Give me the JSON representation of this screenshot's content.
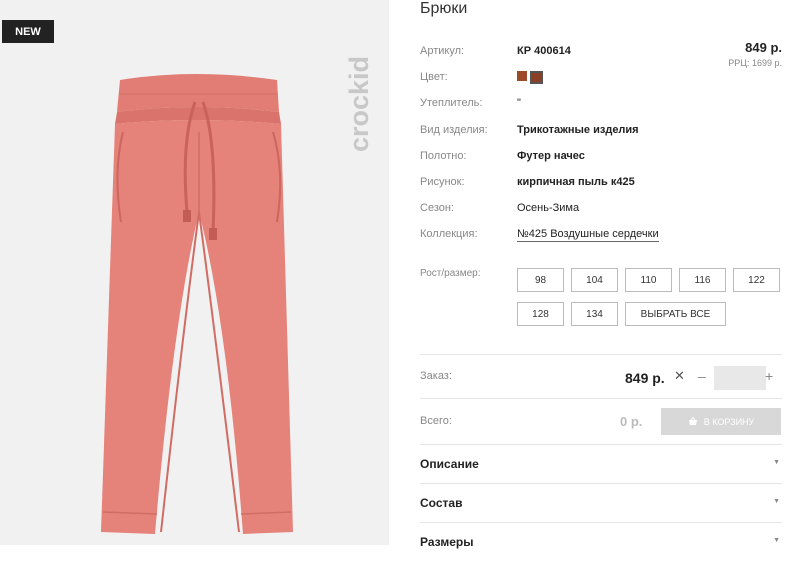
{
  "badge": "NEW",
  "brand": "crockid",
  "product": {
    "title": "Брюки",
    "price": "849 р.",
    "rrp": "РРЦ: 1699 р."
  },
  "attributes": [
    {
      "label": "Артикул:",
      "value": "КР 400614",
      "bold": true
    },
    {
      "label": "Цвет:",
      "value": ""
    },
    {
      "label": "Утеплитель:",
      "value": "\""
    },
    {
      "label": "Вид изделия:",
      "value": "Трикотажные изделия",
      "bold": true
    },
    {
      "label": "Полотно:",
      "value": "Футер начес",
      "bold": true
    },
    {
      "label": "Рисунок:",
      "value": "кирпичная пыль к425",
      "bold": true
    },
    {
      "label": "Сезон:",
      "value": "Осень-Зима"
    },
    {
      "label": "Коллекция:",
      "value": "№425 Воздушные сердечки",
      "link": true
    }
  ],
  "colors": {
    "swatch": "#9b4a2a",
    "cart_button": "#d8d8d8",
    "image_bg": "#f1f1f1"
  },
  "sizes": {
    "label": "Рост/размер:",
    "options": [
      "98",
      "104",
      "110",
      "116",
      "122",
      "128",
      "134"
    ],
    "select_all": "ВЫБРАТЬ ВСЕ"
  },
  "order": {
    "label": "Заказ:",
    "price": "849 р.",
    "times": "✕",
    "minus": "–",
    "plus": "+",
    "quantity": ""
  },
  "total": {
    "label": "Всего:",
    "value": "0 р.",
    "cart_label": "В КОРЗИНУ"
  },
  "sections": [
    "Описание",
    "Состав",
    "Размеры"
  ]
}
